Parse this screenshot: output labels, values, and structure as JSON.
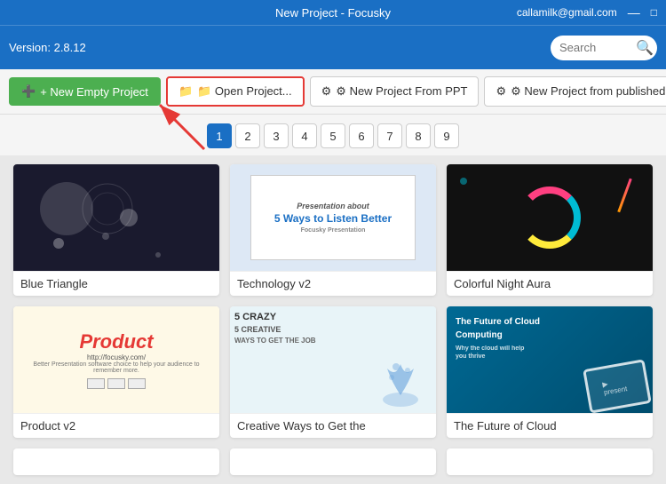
{
  "titleBar": {
    "title": "New Project - Focusky",
    "email": "callamilk@gmail.com",
    "minimize": "—",
    "maximize": "□"
  },
  "menuBar": {
    "version": "Version: 2.8.12",
    "search": {
      "placeholder": "Search",
      "icon": "🔍"
    }
  },
  "toolbar": {
    "newEmpty": "+ New Empty Project",
    "openProject": "📁 Open Project...",
    "newFromPPT": "⚙ New Project From PPT",
    "newFromPublished": "⚙ New Project from published files"
  },
  "pagination": {
    "pages": [
      "1",
      "2",
      "3",
      "4",
      "5",
      "6",
      "7",
      "8",
      "9"
    ],
    "active": 0
  },
  "cards": [
    {
      "id": "blue-triangle",
      "label": "Blue Triangle",
      "type": "blue-triangle"
    },
    {
      "id": "technology-v2",
      "label": "Technology v2",
      "type": "tech"
    },
    {
      "id": "colorful-night-aura",
      "label": "Colorful Night Aura",
      "type": "colorful"
    },
    {
      "id": "product-v2",
      "label": "Product v2",
      "type": "product"
    },
    {
      "id": "creative-ways",
      "label": "Creative Ways to Get the",
      "type": "creative"
    },
    {
      "id": "future-of-cloud",
      "label": "The Future of Cloud",
      "type": "cloud"
    }
  ],
  "creative": {
    "line1": "5 CRAZY",
    "line2": "5 CREATIVE",
    "line3": "WAYS TO GET THE JOB"
  },
  "cloud": {
    "line1": "The Future of Cloud",
    "line2": "Computing"
  },
  "product": {
    "title": "Product",
    "url": "http://focusky.com/",
    "sub": "Better Presentation software choice to help your audience to remember more."
  }
}
